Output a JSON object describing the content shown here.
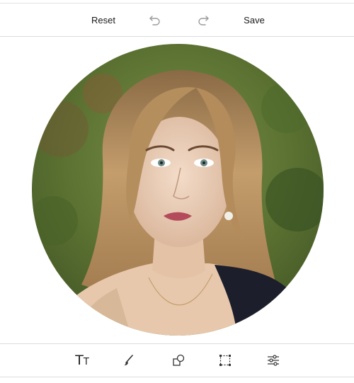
{
  "toolbar": {
    "reset_label": "Reset",
    "save_label": "Save",
    "undo_icon": "undo-icon",
    "redo_icon": "redo-icon"
  },
  "image": {
    "subject": "portrait-photo",
    "shape": "circle"
  },
  "tools": [
    {
      "icon": "text-icon",
      "glyph_big": "T",
      "glyph_small": "T"
    },
    {
      "icon": "brush-icon"
    },
    {
      "icon": "shapes-icon"
    },
    {
      "icon": "crop-icon"
    },
    {
      "icon": "adjustments-icon"
    }
  ],
  "colors": {
    "divider": "#dcdcdc",
    "icon": "#555555",
    "text": "#1a1a1a"
  }
}
